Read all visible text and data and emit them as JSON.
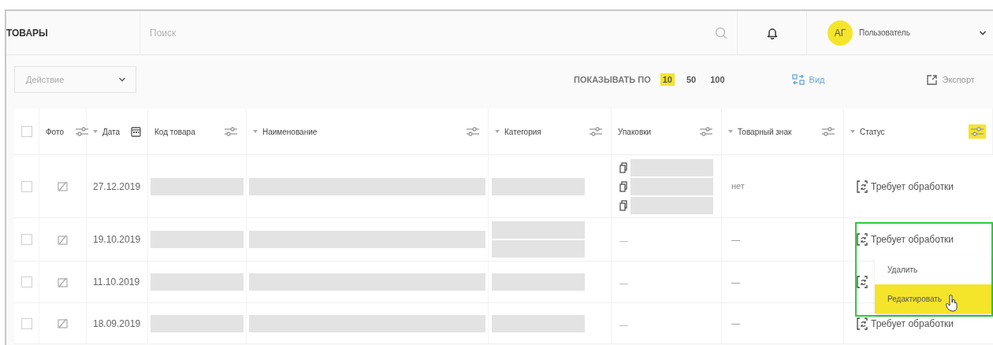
{
  "header": {
    "title": "ТОВАРЫ",
    "search": {
      "placeholder": "Поиск"
    },
    "user": {
      "initials": "АГ",
      "name": "Пользователь"
    }
  },
  "toolbar": {
    "action": {
      "placeholder": "Действие"
    },
    "page_size": {
      "label": "ПОКАЗЫВАТЬ ПО",
      "options": [
        {
          "label": "10",
          "selected": true
        },
        {
          "label": "50",
          "selected": false
        },
        {
          "label": "100",
          "selected": false
        }
      ]
    },
    "view": "Вид",
    "export": "Экспорт"
  },
  "table": {
    "select_all": {
      "checked": false
    },
    "columns": [
      {
        "label": "Фото",
        "sort": false,
        "kind": "filter",
        "active": false
      },
      {
        "label": "Дата",
        "sort": true,
        "kind": "calendar",
        "active": false
      },
      {
        "label": "Код товара",
        "sort": false,
        "kind": "filter",
        "active": false
      },
      {
        "label": "Наименование",
        "sort": true,
        "kind": "filter",
        "active": false
      },
      {
        "label": "Категория",
        "sort": true,
        "kind": "filter",
        "active": false
      },
      {
        "label": "Упаковки",
        "sort": false,
        "kind": "filter",
        "active": false
      },
      {
        "label": "Товарный знак",
        "sort": true,
        "kind": "filter",
        "active": false
      },
      {
        "label": "Статус",
        "sort": true,
        "kind": "filter",
        "active": true
      }
    ],
    "rows": [
      {
        "checked": false,
        "date": "27.12.2019",
        "category": [
          {
            "kind": "redacted"
          }
        ],
        "packages": [
          {
            "kind": "redacted"
          },
          {
            "kind": "redacted"
          },
          {
            "kind": "redacted"
          }
        ],
        "trademark": "нет",
        "status": {
          "kind": "icon-text",
          "text": "Требует обработки"
        }
      },
      {
        "checked": false,
        "date": "19.10.2019",
        "category": [
          {
            "kind": "redacted"
          },
          {
            "kind": "redacted"
          }
        ],
        "packages": [
          {
            "kind": "text",
            "text": "—"
          }
        ],
        "trademark": "—",
        "status": {
          "kind": "icon-text",
          "text": "Требует обработки"
        }
      },
      {
        "checked": false,
        "date": "11.10.2019",
        "category": [
          {
            "kind": "redacted"
          }
        ],
        "packages": [
          {
            "kind": "text",
            "text": "—"
          }
        ],
        "trademark": "—",
        "status": {
          "kind": "icon-only"
        }
      },
      {
        "checked": false,
        "date": "18.09.2019",
        "category": [
          {
            "kind": "redacted"
          }
        ],
        "packages": [
          {
            "kind": "text",
            "text": "—"
          }
        ],
        "trademark": "—",
        "status": {
          "kind": "icon-text",
          "text": "Требует обработки"
        }
      }
    ]
  },
  "context_menu": {
    "items": [
      {
        "label": "Удалить",
        "selected": false
      },
      {
        "label": "Редактировать",
        "selected": true
      }
    ]
  }
}
